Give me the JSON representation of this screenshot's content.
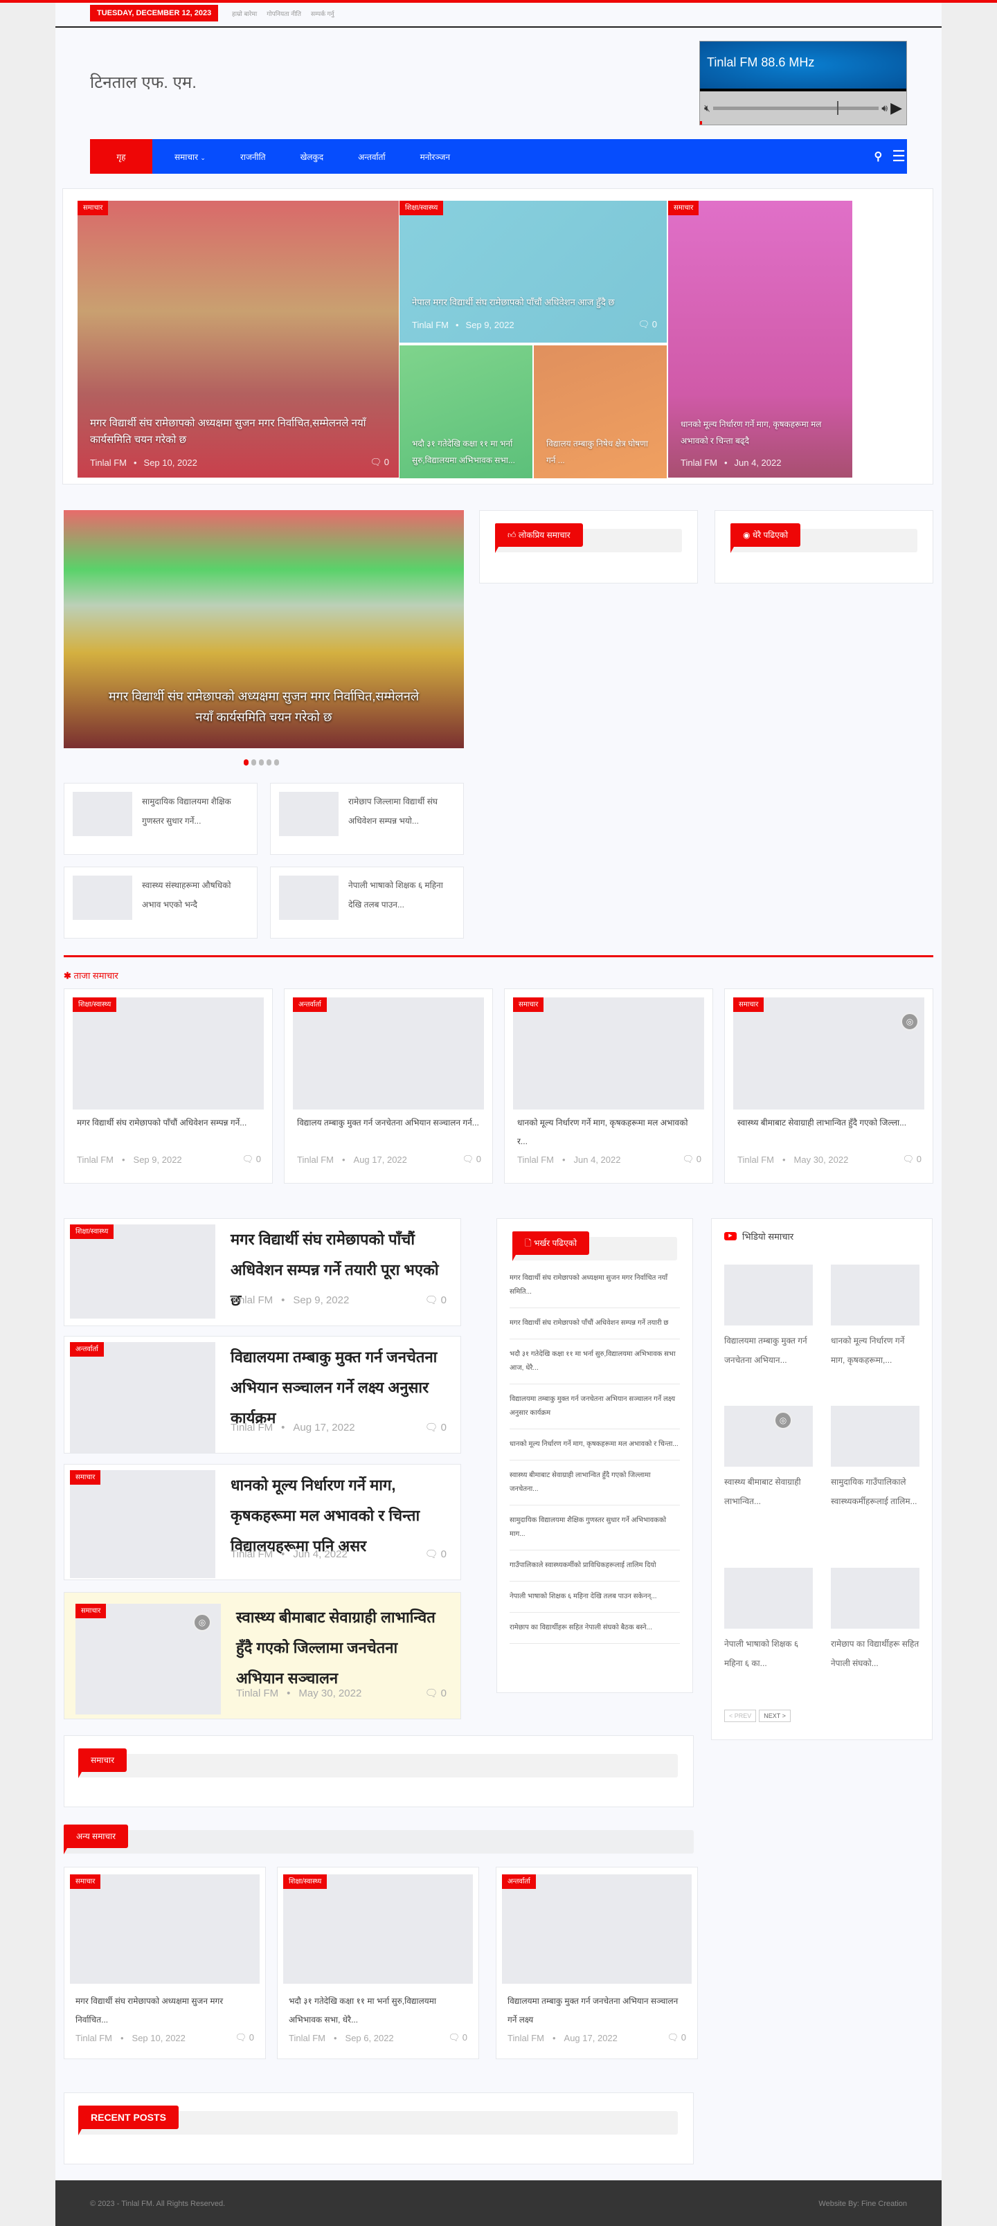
{
  "topbar": {
    "date": "TUESDAY, DECEMBER 12, 2023",
    "links": [
      "हाम्रो बारेमा",
      "गोपनियता नीति",
      "सम्पर्क गर्नु"
    ]
  },
  "header": {
    "logo": "टिनताल एफ. एम.",
    "player": {
      "station": "Tinlal FM 88.6 MHz",
      "volume": 0.75
    }
  },
  "nav": {
    "items": [
      "गृह",
      "समाचार",
      "राजनीति",
      "खेलकुद",
      "अन्तर्वार्ता",
      "मनोरञ्जन"
    ]
  },
  "featured": [
    {
      "cat": "समाचार",
      "title": "मगर विद्यार्थी संघ रामेछापको अध्यक्षमा सुजन मगर निर्वाचित,सम्मेलनले नयाँ कार्यसमिति चयन गरेको छ",
      "author": "Tinlal FM",
      "date": "Sep 10, 2022",
      "comments": "0"
    },
    {
      "cat": "शिक्षा/स्वास्थ्य",
      "title": "नेपाल मगर विद्यार्थी संघ रामेछापको पाँचौं अधिवेशन आज हुँदै छ",
      "author": "Tinlal FM",
      "date": "Sep 9, 2022",
      "comments": "0"
    },
    {
      "cat": "",
      "title": "भदौ ३१ गतेदेखि कक्षा ११ मा भर्ना सुरु,विद्यालयमा अभिभावक सभा...",
      "author": "",
      "date": "",
      "comments": ""
    },
    {
      "cat": "",
      "title": "विद्यालय तम्बाकु निषेध क्षेत्र घोषणा गर्न ...",
      "author": "",
      "date": "",
      "comments": ""
    },
    {
      "cat": "समाचार",
      "title": "धानको मूल्य निर्धारण गर्ने माग, कृषकहरूमा मल अभावको र चिन्ता बढ्दै",
      "author": "Tinlal FM",
      "date": "Jun 4, 2022",
      "comments": "0"
    }
  ],
  "slider": {
    "caption": "मगर विद्यार्थी संघ रामेछापको अध्यक्षमा सुजन मगर निर्वाचित,सम्मेलनले नयाँ कार्यसमिति चयन गरेको छ",
    "slides": 5,
    "active": 1
  },
  "small_posts": [
    "सामुदायिक विद्यालयमा शैक्षिक गुणस्तर सुधार गर्ने...",
    "रामेछाप जिल्लामा विद्यार्थी संघ अधिवेशन सम्पन्न भयो...",
    "स्वास्थ्य संस्थाहरूमा औषधिको अभाव भएको भन्दै",
    "नेपाली भाषाको शिक्षक ६ महिना देखि तलब पाउन..."
  ],
  "widgets": {
    "popular": "लोकप्रिय समाचार",
    "trending": "धेरै पढिएको"
  },
  "section_latest": {
    "title": "ताजा समाचार",
    "cards": [
      {
        "cat": "शिक्षा/स्वास्थ्य",
        "title": "मगर विद्यार्थी संघ रामेछापको पाँचौं अधिवेशन सम्पन्न गर्ने...",
        "date": "Sep 9, 2022"
      },
      {
        "cat": "अन्तर्वार्ता",
        "title": "विद्यालय तम्बाकु मुक्त गर्न जनचेतना अभियान सञ्चालन गर्न...",
        "date": "Aug 17, 2022"
      },
      {
        "cat": "समाचार",
        "title": "धानको मूल्य निर्धारण गर्ने माग, कृषकहरूमा मल अभावको र...",
        "date": "Jun 4, 2022"
      },
      {
        "cat": "समाचार",
        "title": "स्वास्थ्य बीमाबाट सेवाग्राही लाभान्वित हुँदै गएको जिल्ला...",
        "date": "May 30, 2022",
        "camera": true
      }
    ]
  },
  "list_posts": [
    {
      "cat": "शिक्षा/स्वास्थ्य",
      "title": "मगर विद्यार्थी संघ रामेछापको पाँचौं अधिवेशन सम्पन्न गर्ने तयारी पूरा भएको छ",
      "date": "Sep 9, 2022"
    },
    {
      "cat": "अन्तर्वार्ता",
      "title": "विद्यालयमा तम्बाकु मुक्त गर्न जनचेतना अभियान सञ्चालन गर्ने लक्ष्य अनुसार कार्यक्रम",
      "date": "Aug 17, 2022"
    },
    {
      "cat": "समाचार",
      "title": "धानको मूल्य निर्धारण गर्ने माग, कृषकहरूमा मल अभावको र चिन्ता विद्यालयहरूमा पनि असर",
      "date": "Jun 4, 2022"
    },
    {
      "cat": "समाचार",
      "title": "स्वास्थ्य बीमाबाट सेवाग्राही लाभान्वित हुँदै गएको जिल्लामा जनचेतना अभियान सञ्चालन",
      "date": "May 30, 2022",
      "camera": true
    }
  ],
  "author": "Tinlal FM",
  "comments": "0",
  "recent_widget": {
    "title": "भर्खर पढिएको",
    "items": [
      "मगर विद्यार्थी संघ रामेछापको अध्यक्षमा सुजन मगर निर्वाचित नयाँ समिति...",
      "मगर विद्यार्थी संघ रामेछापको पाँचौं अधिवेशन सम्पन्न गर्ने तयारी छ",
      "भदौ ३१ गतेदेखि कक्षा ११ मा भर्ना सुरु,विद्यालयमा अभिभावक सभा आज, धेरै...",
      "विद्यालयमा तम्बाकु मुक्त गर्न जनचेतना अभियान सञ्चालन गर्ने लक्ष्य अनुसार कार्यक्रम",
      "धानको मूल्य निर्धारण गर्ने माग, कृषकहरूमा मल अभावको र चिन्ता...",
      "स्वास्थ्य बीमाबाट सेवाग्राही लाभान्वित हुँदै गएको जिल्लामा जनचेतना...",
      "सामुदायिक विद्यालयमा शैक्षिक गुणस्तर सुधार गर्ने अभिभावकको माग...",
      "गाउँपालिकाले स्वास्थ्यकर्मीको प्राविधिकहरूलाई तालिम दियो",
      "नेपाली भाषाको शिक्षक ६ महिना देखि तलब पाउन सकेनन्...",
      "रामेछाप का विद्यार्थीहरू सहित नेपाली संघको बैठक बस्ने..."
    ]
  },
  "video_widget": {
    "title": "भिडियो समाचार",
    "items": [
      "विद्यालयमा तम्बाकु मुक्त गर्न जनचेतना अभियान...",
      "धानको मूल्य निर्धारण गर्ने माग, कृषकहरूमा,...",
      "स्वास्थ्य बीमाबाट सेवाग्राही लाभान्वित...",
      "सामुदायिक गाउँपालिकाले स्वास्थ्यकर्मीहरूलाई तालिम...",
      "नेपाली भाषाको शिक्षक ६ महिना ६ का...",
      "रामेछाप का विद्यार्थीहरू सहित नेपाली संघको..."
    ],
    "prev": "< PREV",
    "next": "NEXT >"
  },
  "box_news": {
    "title": "समाचार"
  },
  "section_more": {
    "title": "अन्य समाचार",
    "cards": [
      {
        "cat": "समाचार",
        "title": "मगर विद्यार्थी संघ रामेछापको अध्यक्षमा सुजन मगर निर्वाचित...",
        "date": "Sep 10, 2022"
      },
      {
        "cat": "शिक्षा/स्वास्थ्य",
        "title": "भदौ ३१ गतेदेखि कक्षा ११ मा भर्ना सुरु,विद्यालयमा अभिभावक सभा, धेरै...",
        "date": "Sep 6, 2022"
      },
      {
        "cat": "अन्तर्वार्ता",
        "title": "विद्यालयमा तम्बाकु मुक्त गर्न जनचेतना अभियान सञ्चालन गर्ने लक्ष्य",
        "date": "Aug 17, 2022"
      }
    ]
  },
  "recent_posts": {
    "title": "RECENT POSTS"
  },
  "footer": {
    "copyright": "© 2023 - Tinlal FM. All Rights Reserved.",
    "credit": "Website By: Fine Creation"
  },
  "colors": {
    "accent": "#ee0606",
    "nav": "#064dfd",
    "footer": "#353535"
  }
}
